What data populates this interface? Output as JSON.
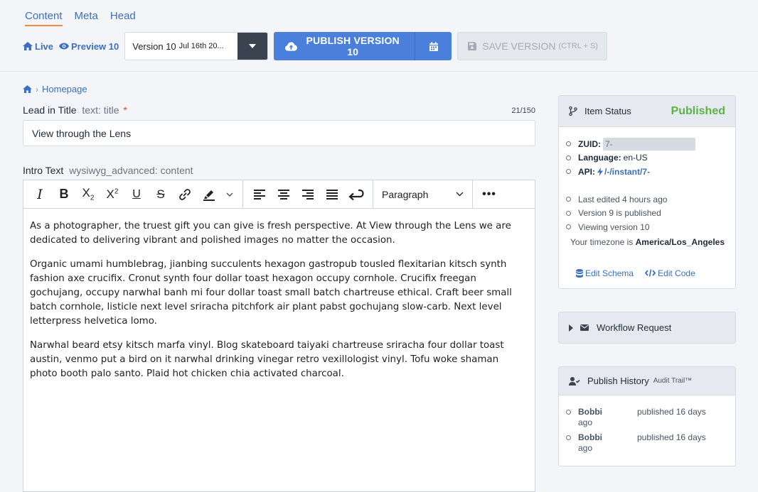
{
  "header": {
    "tabs": [
      {
        "label": "Content",
        "active": true
      },
      {
        "label": "Meta",
        "active": false
      },
      {
        "label": "Head",
        "active": false
      }
    ],
    "live_label": "Live",
    "preview_label": "Preview 10",
    "version_main": "Version 10",
    "version_date": "Jul 16th 20...",
    "publish_label": "PUBLISH VERSION 10",
    "save_label": "SAVE VERSION",
    "save_shortcut": "(CTRL + S)"
  },
  "breadcrumb": {
    "home_icon": "home-icon",
    "item": "Homepage"
  },
  "fields": {
    "title": {
      "label": "Lead in Title",
      "meta": "text: title",
      "required": "*",
      "count": "21/150",
      "value": "View through the Lens"
    },
    "intro": {
      "label": "Intro Text",
      "meta": "wysiwyg_advanced: content"
    }
  },
  "editor": {
    "block_format": "Paragraph",
    "paragraphs": [
      "As a photographer, the truest gift you can give is fresh perspective. At View through the Lens we are dedicated to delivering vibrant and polished images no matter the occasion.",
      "Organic umami humblebrag, jianbing succulents hexagon gastropub tousled flexitarian kitsch synth fashion axe crucifix. Cronut synth four dollar toast hexagon occupy cornhole. Crucifix freegan gochujang, occupy narwhal banh mi four dollar toast small batch chartreuse ethical. Craft beer small batch cornhole, listicle next level sriracha pitchfork air plant pabst gochujang slow-carb. Next level letterpress helvetica lomo.",
      "Narwhal beard etsy kitsch marfa vinyl. Blog skateboard taiyaki chartreuse sriracha four dollar toast austin, venmo put a bird on it narwhal drinking vinegar retro vexillologist vinyl. Tofu woke shaman photo booth palo santo. Plaid hot chicken chia activated charcoal."
    ]
  },
  "item_status": {
    "title": "Item Status",
    "badge": "Published",
    "zuid_key": "ZUID:",
    "zuid_value": "7-",
    "language_key": "Language:",
    "language_value": "en-US",
    "api_key": "API:",
    "api_value": "/-/instant/7-",
    "last_edited": "Last edited 4 hours ago",
    "published_version": "Version 9 is published",
    "viewing_version": "Viewing version 10",
    "tz_prefix": "Your timezone is",
    "tz_value": "America/Los_Angeles",
    "edit_schema": "Edit Schema",
    "edit_code": "Edit Code"
  },
  "workflow": {
    "title": "Workflow Request"
  },
  "publish_history": {
    "title": "Publish History",
    "subtitle": "Audit Trail™",
    "entries": [
      {
        "user": "Bobbi",
        "ago": "ago",
        "action": "published 16 days"
      },
      {
        "user": "Bobbi",
        "ago": "ago",
        "action": "published 16 days"
      }
    ]
  },
  "colors": {
    "accent": "#4a7fdc",
    "link": "#3b6fc0",
    "published": "#5ab445",
    "active_tab_underline": "#f08a3c"
  }
}
